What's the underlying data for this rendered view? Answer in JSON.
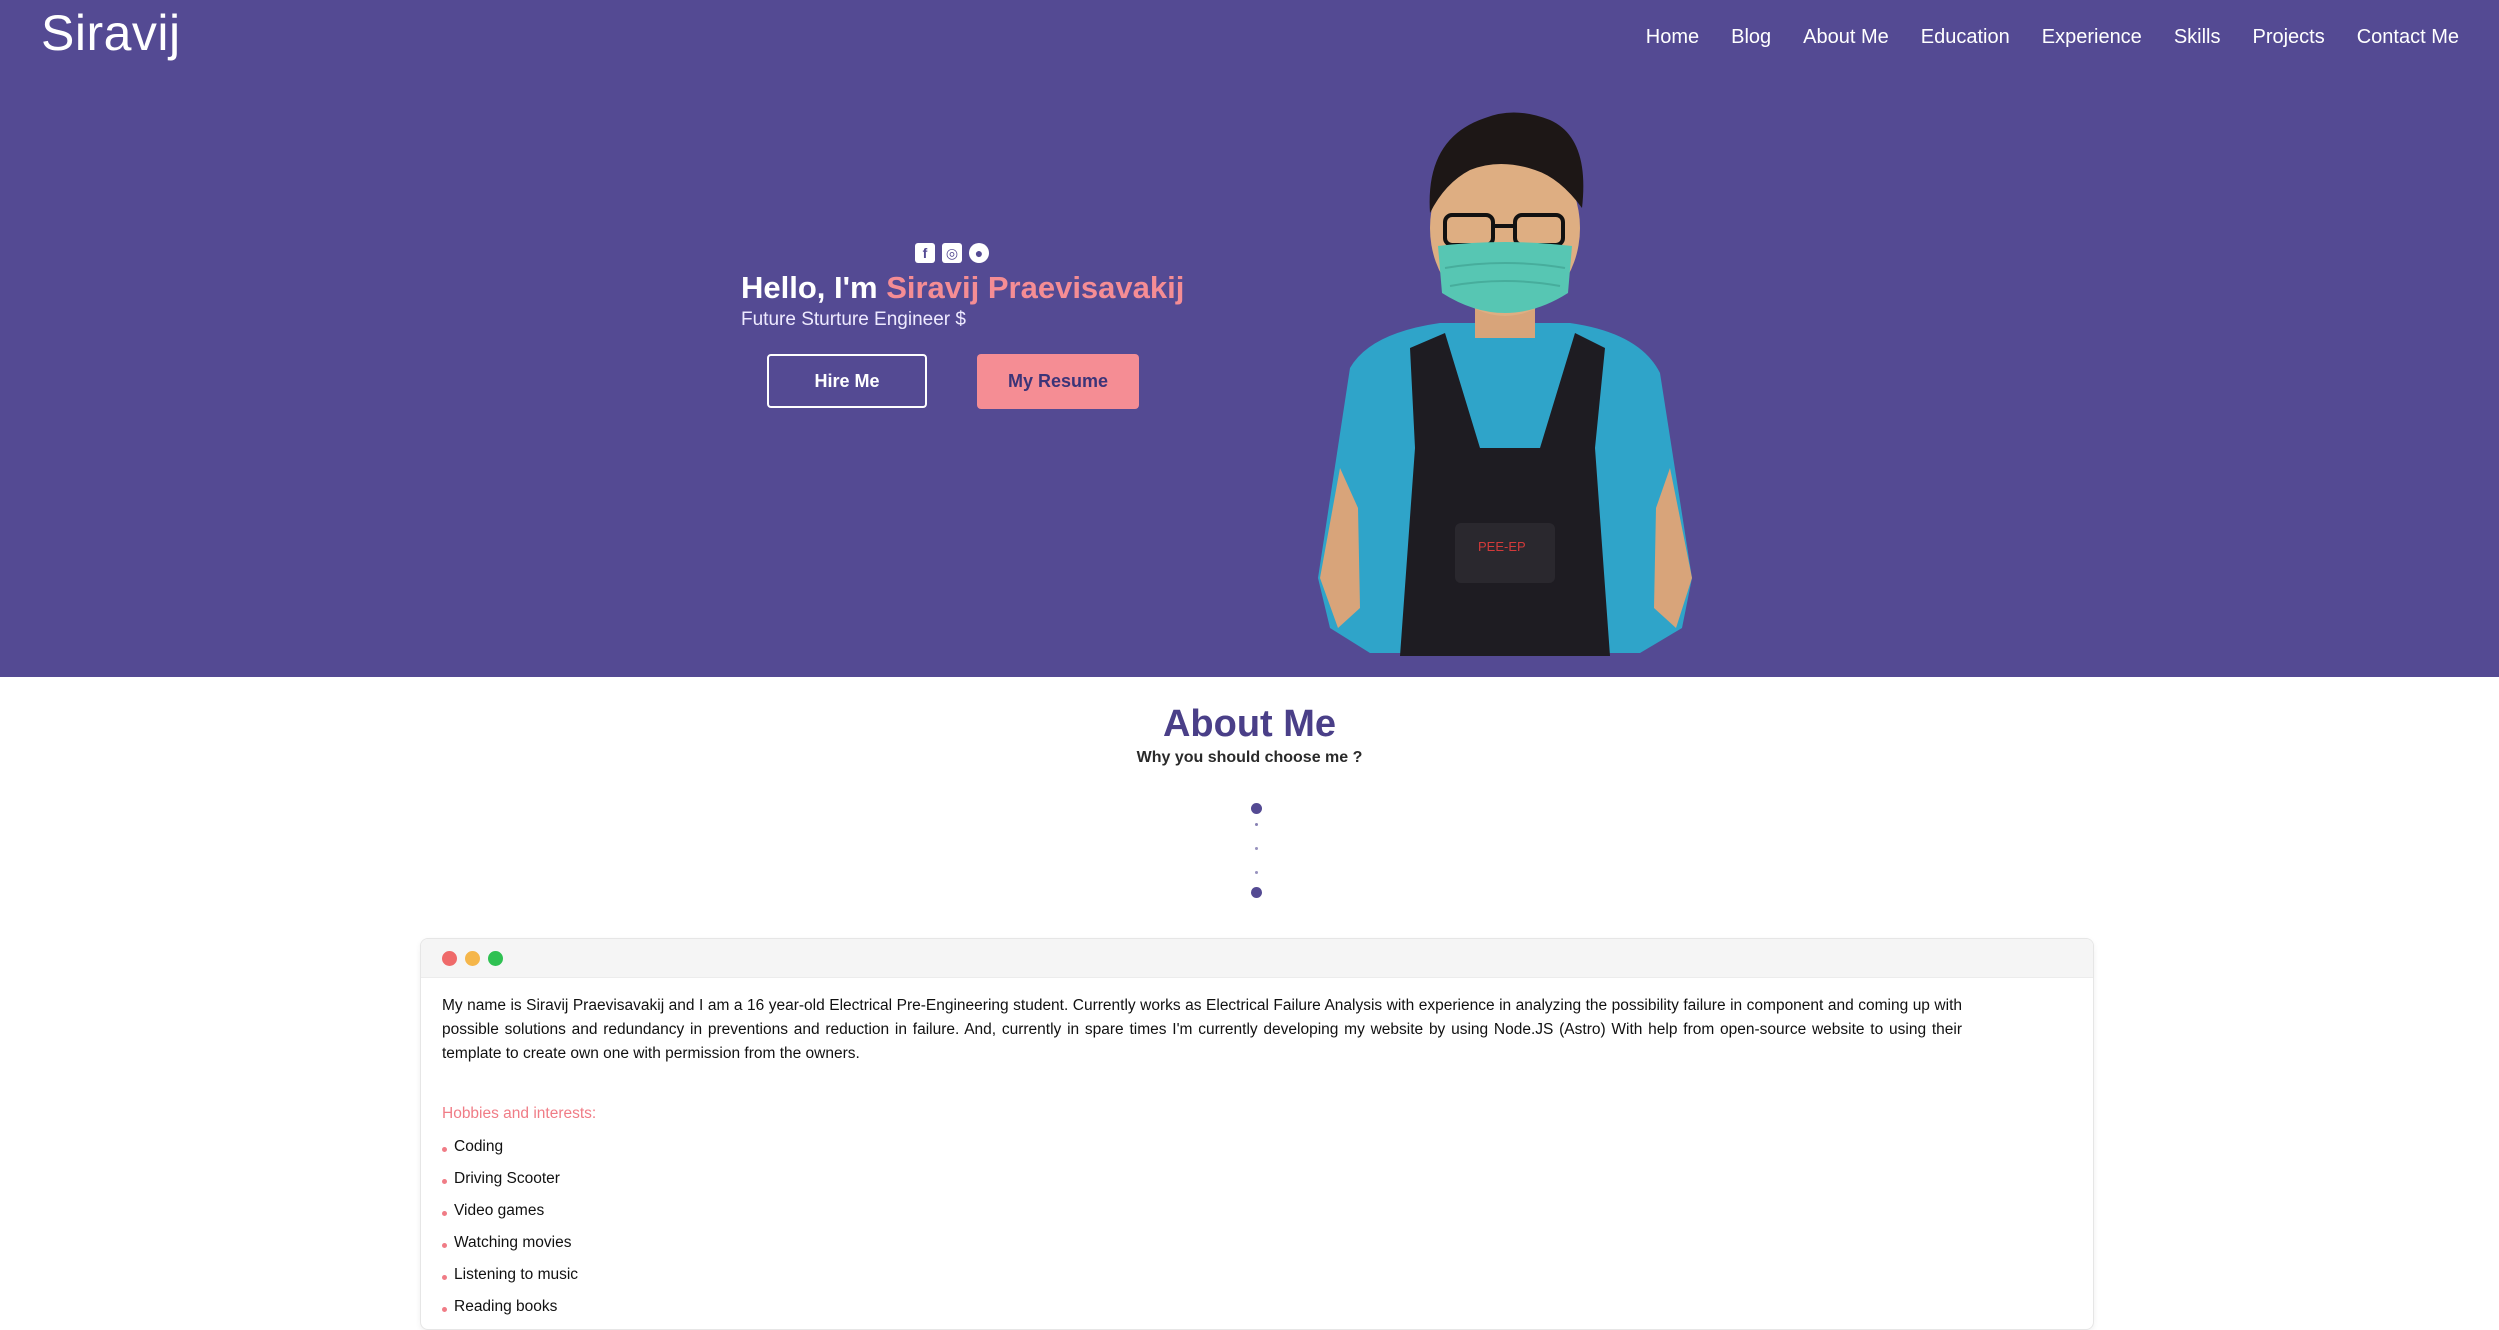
{
  "header": {
    "brand": "Siravij",
    "nav": [
      "Home",
      "Blog",
      "About Me",
      "Education",
      "Experience",
      "Skills",
      "Projects",
      "Contact Me"
    ]
  },
  "hero": {
    "socials": [
      {
        "icon": "facebook-icon",
        "glyph": "f"
      },
      {
        "icon": "instagram-icon",
        "glyph": "◎"
      },
      {
        "icon": "github-icon",
        "glyph": "●"
      }
    ],
    "greeting_prefix": "Hello, I'm ",
    "name": "Siravij Praevisavakij",
    "tagline": "Future Sturture Engineer $",
    "hire_label": "Hire Me",
    "resume_label": "My Resume"
  },
  "about": {
    "title": "About Me",
    "subtitle": "Why you should choose me ?",
    "bio": "My name is Siravij Praevisavakij and I am a 16 year-old Electrical Pre-Engineering student. Currently works as Electrical Failure Analysis with experience in analyzing the possibility failure in component and coming up with possible solutions and redundancy in preventions and reduction in failure. And, currently in spare times I'm currently developing my website by using Node.JS (Astro) With help from open-source website to using their template to create own one with permission from the owners.",
    "hobbies_title": "Hobbies and interests:",
    "hobbies": [
      "Coding",
      "Driving Scooter",
      "Video games",
      "Watching movies",
      "Listening to music",
      "Reading books"
    ]
  },
  "colors": {
    "hero_bg": "#544a93",
    "accent": "#f58d94",
    "title": "#4a3f88",
    "window_dots": [
      "#ef6a6a",
      "#f5b64a",
      "#2fc152"
    ]
  }
}
